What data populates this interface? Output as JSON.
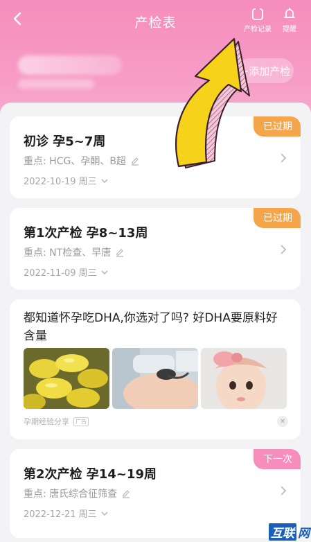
{
  "header": {
    "title": "产检表",
    "record_label": "产检记录",
    "reminder_label": "提醒",
    "add_button_label": "+添加产检"
  },
  "exams": [
    {
      "title": "初诊  孕5~7周",
      "focus": "重点: HCG、孕酮、B超",
      "date": "2022-10-19 周三",
      "status": "已过期"
    },
    {
      "title": "第1次产检  孕8~13周",
      "focus": "重点: NT检查、早唐",
      "date": "2022-11-09 周三",
      "status": "已过期"
    },
    {
      "title": "第2次产检  孕14~19周",
      "focus": "重点: 唐氏综合征筛查",
      "date": "2022-12-21 周三",
      "status": "下一次"
    }
  ],
  "ad": {
    "title": "都知道怀孕吃DHA,你选对了吗? 好DHA要原料好含量",
    "source": "孕期经验分享",
    "tag": "广告",
    "close_symbol": "✕"
  },
  "watermark": {
    "box_text": "互联",
    "text": "网"
  },
  "colors": {
    "header_pink": "#f58dbd",
    "badge_expired": "#f5a64a",
    "badge_next": "#f58dbd",
    "arrow_yellow": "#f7d21a"
  }
}
